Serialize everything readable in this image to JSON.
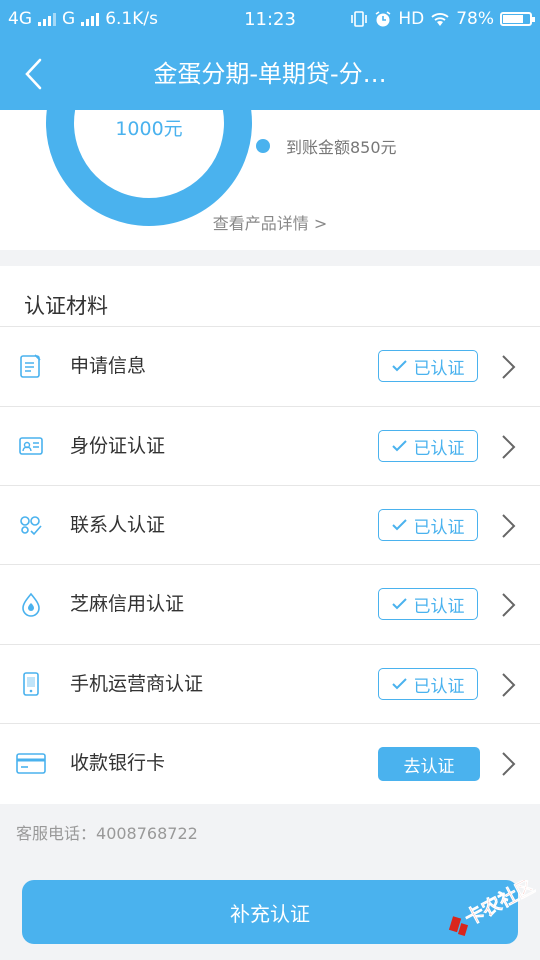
{
  "status_bar": {
    "net1": "4G",
    "net2": "G",
    "speed": "6.1K/s",
    "time": "11:23",
    "hd": "HD",
    "battery": "78%",
    "battery_level": 0.78
  },
  "header": {
    "title": "金蛋分期-单期贷-分…",
    "back_icon": "chevron-left-icon"
  },
  "product": {
    "donut_label": "1000元",
    "legend": "到账金额850元",
    "detail_link": "查看产品详情 >"
  },
  "materials": {
    "title": "认证材料",
    "items": [
      {
        "label": "申请信息",
        "status": "已认证",
        "done": true,
        "icon": "form-icon"
      },
      {
        "label": "身份证认证",
        "status": "已认证",
        "done": true,
        "icon": "id-card-icon"
      },
      {
        "label": "联系人认证",
        "status": "已认证",
        "done": true,
        "icon": "contacts-icon"
      },
      {
        "label": "芝麻信用认证",
        "status": "已认证",
        "done": true,
        "icon": "sesame-drop-icon"
      },
      {
        "label": "手机运营商认证",
        "status": "已认证",
        "done": true,
        "icon": "phone-icon"
      },
      {
        "label": "收款银行卡",
        "status": "去认证",
        "done": false,
        "icon": "bank-card-icon"
      }
    ]
  },
  "service": {
    "label": "客服电话：",
    "phone": "4008768722"
  },
  "submit_label": "补充认证",
  "watermark": "卡农社区",
  "colors": {
    "primary": "#4ab2ee",
    "background": "#f2f3f5"
  }
}
